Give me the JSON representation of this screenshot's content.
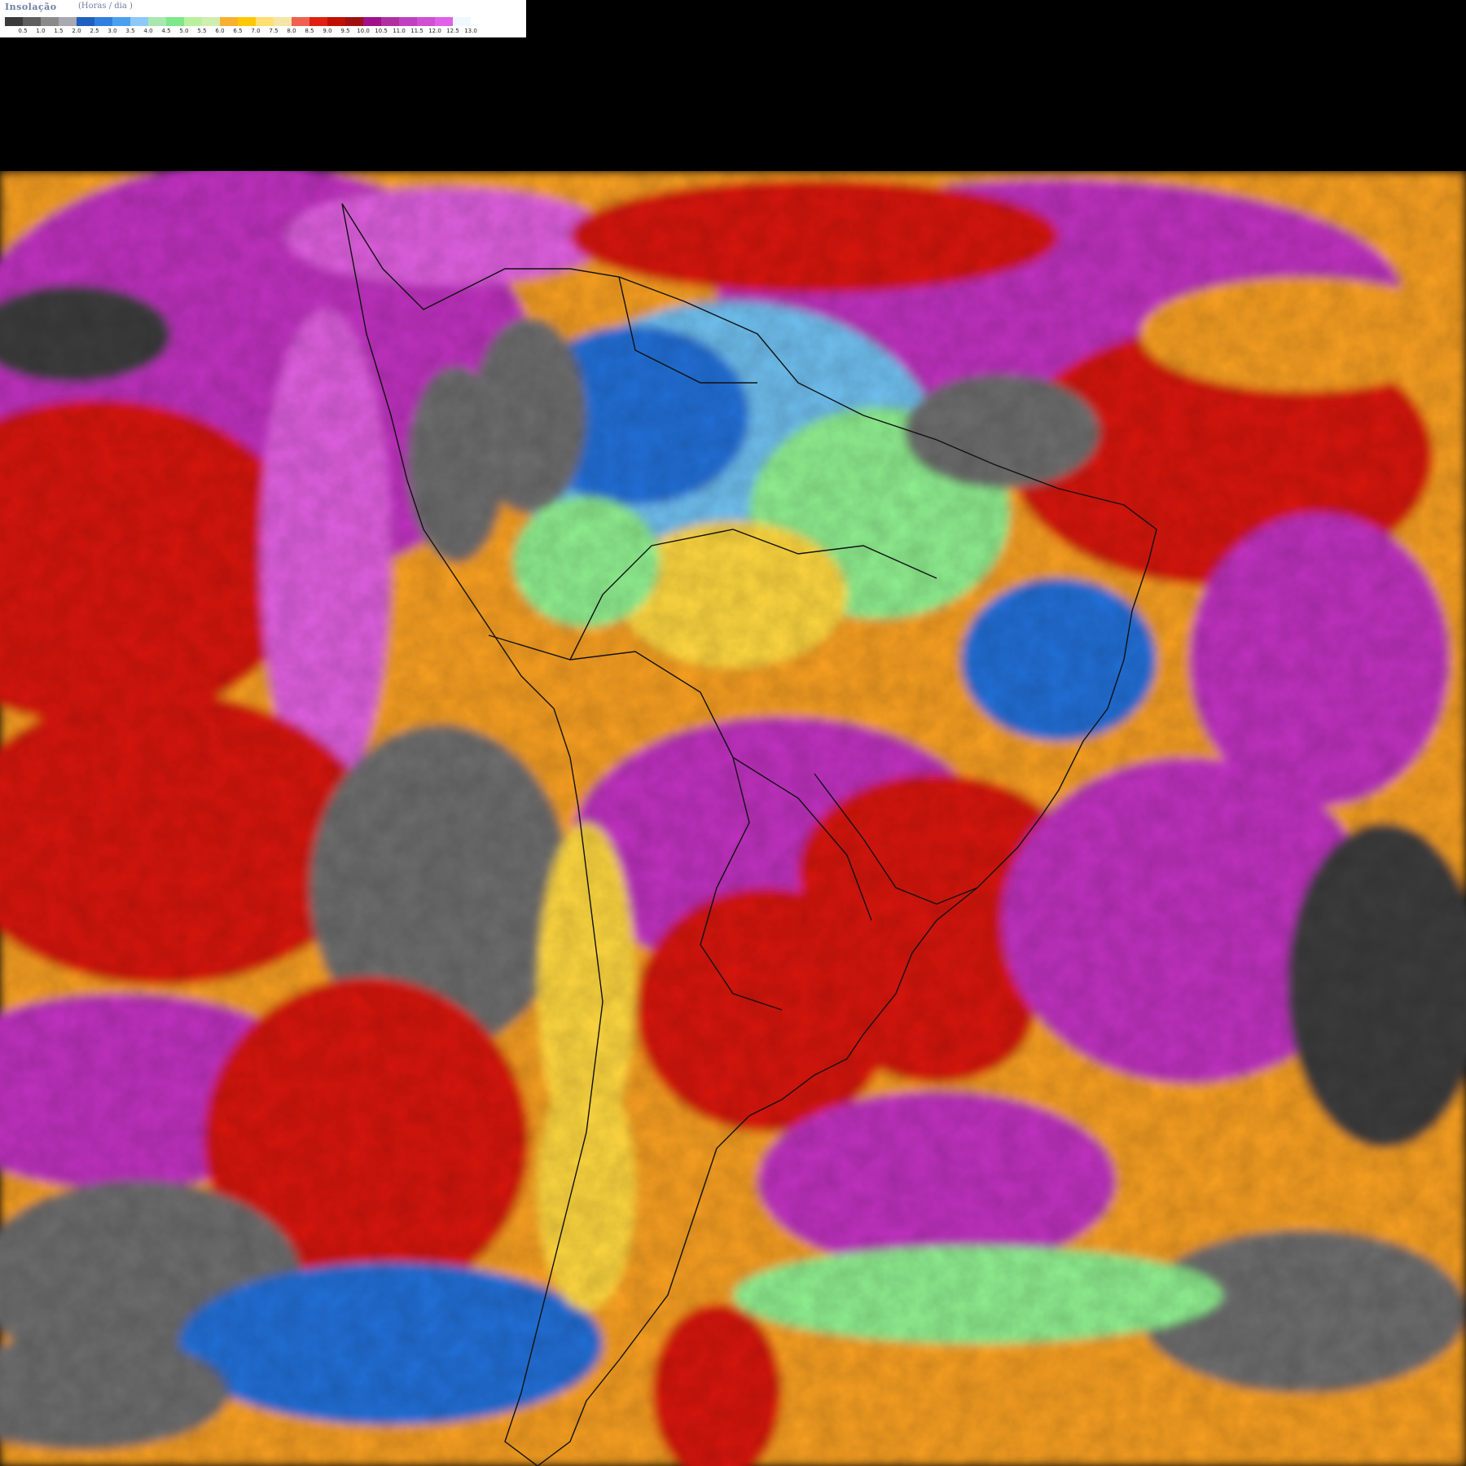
{
  "legend": {
    "title": "Insolação",
    "unit": "(Horas / dia )",
    "swatch_colors": [
      "#3a3a3a",
      "#5e5e5e",
      "#8a8a8a",
      "#a9a9b4",
      "#1f5fbf",
      "#2f7fdf",
      "#4aa0ef",
      "#8cc8f8",
      "#a8e8b0",
      "#7fe88a",
      "#b8f0a0",
      "#cfeeb0",
      "#f8b030",
      "#ffc800",
      "#ffe070",
      "#f5e6a8",
      "#f06050",
      "#e02010",
      "#c01000",
      "#a01010",
      "#a0108a",
      "#b030a0",
      "#c040c0",
      "#d050d0",
      "#e060e8",
      "#f0f8ff",
      "#ffffff"
    ],
    "ticks": [
      "0.5",
      "1.0",
      "1.5",
      "2.0",
      "2.5",
      "3.0",
      "3.5",
      "4.0",
      "4.5",
      "5.0",
      "5.5",
      "6.0",
      "6.5",
      "7.0",
      "7.5",
      "8.0",
      "8.5",
      "9.0",
      "9.5",
      "10.0",
      "10.5",
      "11.0",
      "11.5",
      "12.0",
      "12.5",
      "13.0"
    ]
  },
  "map": {
    "background": "#000000",
    "palette": {
      "magenta": "#c030c0",
      "pink": "#e060e0",
      "red": "#d81810",
      "orange": "#f8a020",
      "yellow": "#ffd840",
      "green": "#90f090",
      "lightblue": "#70c0f0",
      "blue": "#2070d8",
      "gray": "#6e6e6e",
      "darkgray": "#3c3c3c"
    }
  }
}
